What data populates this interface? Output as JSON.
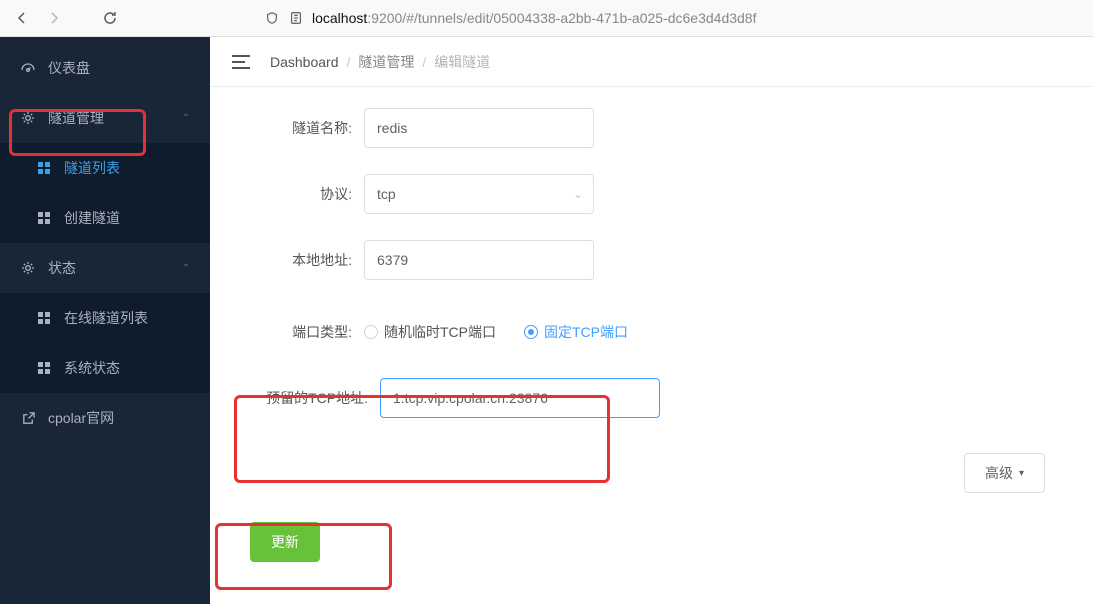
{
  "browser": {
    "url_prefix": "localhost",
    "url_suffix": ":9200/#/tunnels/edit/05004338-a2bb-471b-a025-dc6e3d4d3d8f"
  },
  "sidebar": {
    "items": [
      {
        "label": "仪表盘"
      },
      {
        "label": "隧道管理"
      },
      {
        "label": "隧道列表"
      },
      {
        "label": "创建隧道"
      },
      {
        "label": "状态"
      },
      {
        "label": "在线隧道列表"
      },
      {
        "label": "系统状态"
      },
      {
        "label": "cpolar官网"
      }
    ]
  },
  "breadcrumb": {
    "home": "Dashboard",
    "mid": "隧道管理",
    "cur": "编辑隧道"
  },
  "form": {
    "name_label": "隧道名称:",
    "name_value": "redis",
    "proto_label": "协议:",
    "proto_value": "tcp",
    "addr_label": "本地地址:",
    "addr_value": "6379",
    "port_type_label": "端口类型:",
    "port_type_random": "随机临时TCP端口",
    "port_type_fixed": "固定TCP端口",
    "reserved_label": "预留的TCP地址:",
    "reserved_value": "1.tcp.vip.cpolar.cn:23876",
    "advanced_label": "高级",
    "submit_label": "更新"
  }
}
